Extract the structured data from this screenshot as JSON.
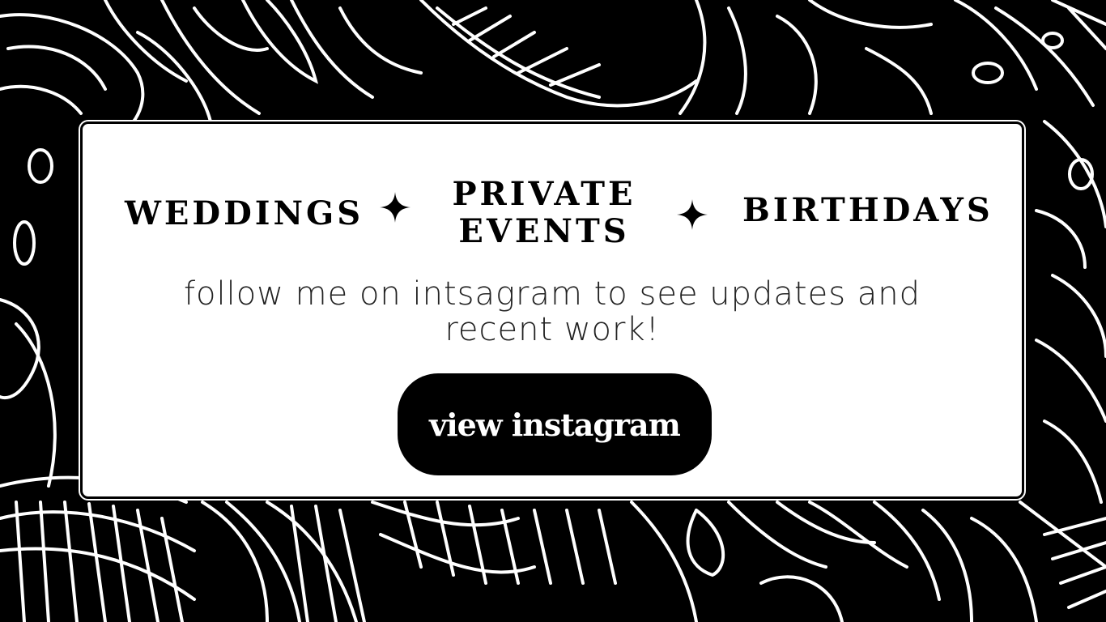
{
  "background": {
    "pattern": "tropical-leaves-line-art",
    "colors": {
      "ground": "#000000",
      "lines": "#ffffff"
    }
  },
  "card": {
    "services": [
      "WEDDINGS",
      "PRIVATE EVENTS",
      "BIRTHDAYS"
    ],
    "separator_icon": "four-point-star-icon",
    "tagline": "follow me on intsagram to see updates and recent work!",
    "cta_label": "view instagram"
  }
}
